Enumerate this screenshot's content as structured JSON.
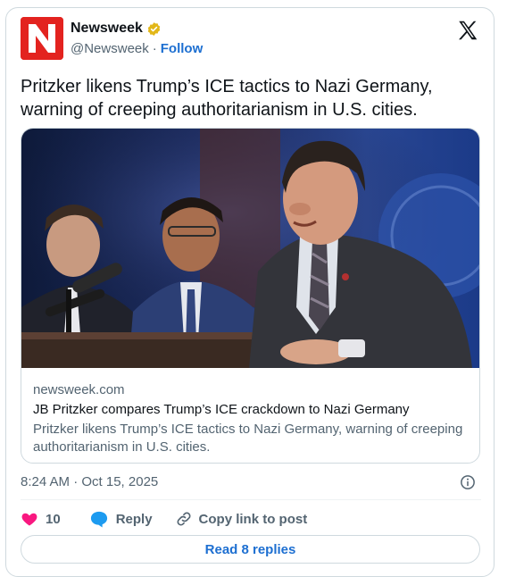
{
  "account": {
    "name": "Newsweek",
    "handle": "@Newsweek",
    "separator": "·",
    "follow_label": "Follow",
    "avatar_letter": "N",
    "brand_color": "#e3231f"
  },
  "tweet": {
    "text": "Pritzker likens Trump’s ICE tactics to Nazi Germany, warning of creeping authoritarianism in U.S. cities."
  },
  "link_card": {
    "domain": "newsweek.com",
    "headline": "JB Pritzker compares Trump’s ICE crackdown to Nazi Germany",
    "description": "Pritzker likens Trump’s ICE tactics to Nazi Germany, warning of creeping authoritarianism in U.S. cities."
  },
  "timestamp": "8:24 AM · Oct 15, 2025",
  "actions": {
    "like_count": "10",
    "reply_label": "Reply",
    "copy_label": "Copy link to post"
  },
  "read_replies_label": "Read 8 replies",
  "colors": {
    "link_blue": "#1d6fd1",
    "like_pink": "#f91880",
    "verified_gold": "#e2b719",
    "secondary_text": "#536471"
  },
  "icons": {
    "verified": "verified-badge-icon",
    "x_logo": "x-logo-icon",
    "info": "info-icon",
    "like": "heart-icon",
    "reply": "reply-bubble-icon",
    "copy": "link-icon"
  }
}
